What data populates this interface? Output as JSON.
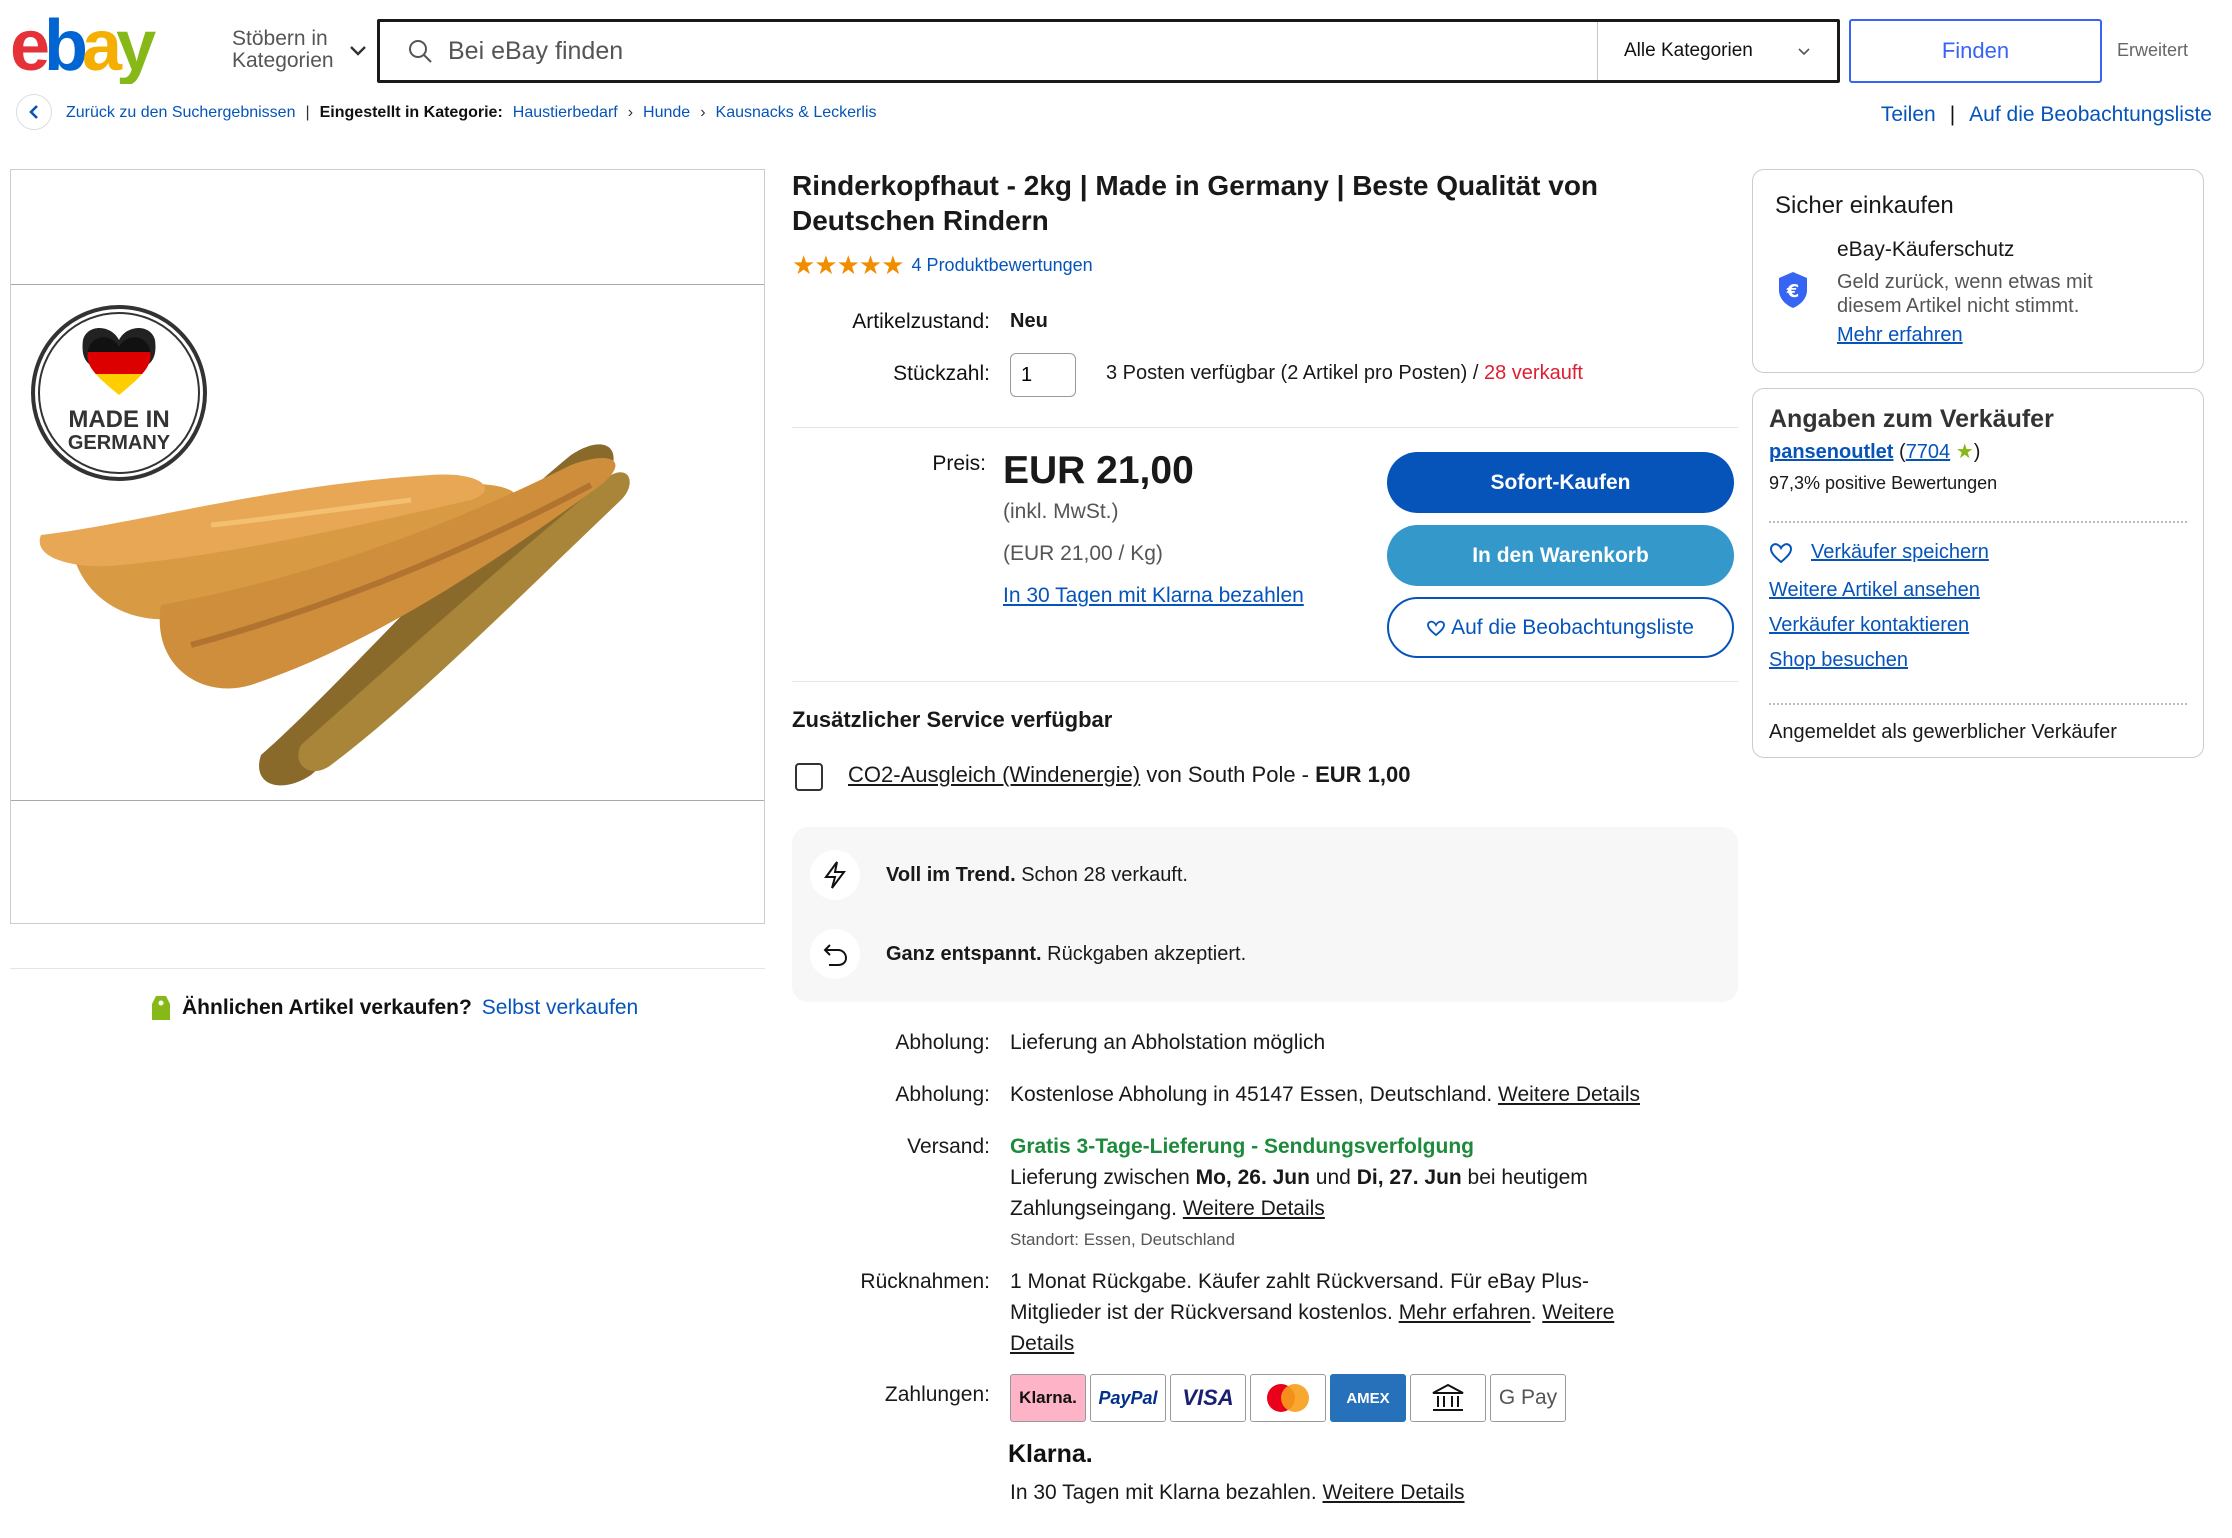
{
  "header": {
    "logo_text": "ebay",
    "browse_label_1": "Stöbern in",
    "browse_label_2": "Kategorien",
    "search_placeholder": "Bei eBay finden",
    "category_select": "Alle Kategorien",
    "find_button": "Finden",
    "advanced_link": "Erweitert"
  },
  "breadcrumb": {
    "back_label": "Zurück zu den Suchergebnissen",
    "listed_in": "Eingestellt in Kategorie:",
    "items": [
      "Haustierbedarf",
      "Hunde",
      "Kausnacks & Leckerlis"
    ]
  },
  "top_actions": {
    "share": "Teilen",
    "separator": "|",
    "watchlist": "Auf die Beobachtungsliste"
  },
  "image": {
    "badge_line1": "MADE IN",
    "badge_line2": "GERMANY"
  },
  "sell_similar": {
    "question": "Ähnlichen Artikel verkaufen?",
    "link": "Selbst verkaufen"
  },
  "product": {
    "title": "Rinderkopfhaut - 2kg | Made in Germany | Beste Qualität von Deutschen Rindern",
    "rating_stars": 5,
    "reviews_link": "4 Produktbewertungen",
    "condition_label": "Artikelzustand:",
    "condition_value": "Neu",
    "quantity_label": "Stückzahl:",
    "quantity_value": "1",
    "availability": "3 Posten verfügbar (2 Artikel pro Posten) /",
    "sold": "28 verkauft",
    "price_label": "Preis:",
    "price": "EUR 21,00",
    "vat_note": "(inkl. MwSt.)",
    "unit_price": "(EUR 21,00 / Kg)",
    "klarna_link": "In 30 Tagen mit Klarna bezahlen",
    "buy_now": "Sofort-Kaufen",
    "add_to_cart": "In den Warenkorb",
    "watch": "Auf die Beobachtungsliste"
  },
  "service": {
    "title": "Zusätzlicher Service verfügbar",
    "co2_link": "CO2-Ausgleich (Windenergie)",
    "co2_rest": " von South Pole - ",
    "co2_price": "EUR 1,00"
  },
  "highlights": [
    {
      "bold": "Voll im Trend.",
      "text": " Schon 28 verkauft.",
      "icon": "lightning-icon"
    },
    {
      "bold": "Ganz entspannt.",
      "text": " Rückgaben akzeptiert.",
      "icon": "return-icon"
    }
  ],
  "details": {
    "pickup1_label": "Abholung:",
    "pickup1_value": "Lieferung an Abholstation möglich",
    "pickup2_label": "Abholung:",
    "pickup2_value": "Kostenlose Abholung in 45147 Essen, Deutschland.",
    "pickup2_link": "Weitere Details",
    "shipping_label": "Versand:",
    "shipping_green": "Gratis 3-Tage-Lieferung - Sendungsverfolgung",
    "shipping_line_a": "Lieferung zwischen ",
    "shipping_date1": "Mo, 26. Jun",
    "shipping_and": " und ",
    "shipping_date2": "Di, 27. Jun",
    "shipping_line_b": " bei heutigem",
    "shipping_line_c": "Zahlungseingang.",
    "shipping_link": "Weitere Details",
    "location": "Standort: Essen, Deutschland",
    "returns_label": "Rücknahmen:",
    "returns_line1": "1 Monat Rückgabe. Käufer zahlt Rückversand. Für eBay Plus-",
    "returns_line2": "Mitglieder ist der Rückversand kostenlos.",
    "returns_link1": "Mehr erfahren",
    "returns_dot": ".",
    "returns_link2a": "Weitere",
    "returns_link2b": "Details",
    "payments_label": "Zahlungen:",
    "payment_methods": [
      "Klarna.",
      "PayPal",
      "VISA",
      "Mastercard",
      "AMEX",
      "Bank",
      "G Pay"
    ],
    "klarna_logo": "Klarna.",
    "klarna_text": "In 30 Tagen mit Klarna bezahlen.",
    "klarna_link": "Weitere Details"
  },
  "safe_buy": {
    "title": "Sicher einkaufen",
    "protection_title": "eBay-Käuferschutz",
    "protection_text1": "Geld zurück, wenn etwas mit",
    "protection_text2": "diesem Artikel nicht stimmt.",
    "learn_more": "Mehr erfahren"
  },
  "seller": {
    "title": "Angaben zum Verkäufer",
    "name": "pansenoutlet",
    "score": "7704",
    "positive": "97,3% positive Bewertungen",
    "save": "Verkäufer speichern",
    "more_items": "Weitere Artikel ansehen",
    "contact": "Verkäufer kontaktieren",
    "shop": "Shop besuchen",
    "business": "Angemeldet als gewerblicher Verkäufer"
  },
  "colors": {
    "primary_blue": "#0654ba",
    "cart_blue": "#3498ca",
    "search_btn_blue": "#3665f3",
    "star_orange": "#f18e00",
    "sold_red": "#dd1e31",
    "green": "#1e8a3c"
  }
}
